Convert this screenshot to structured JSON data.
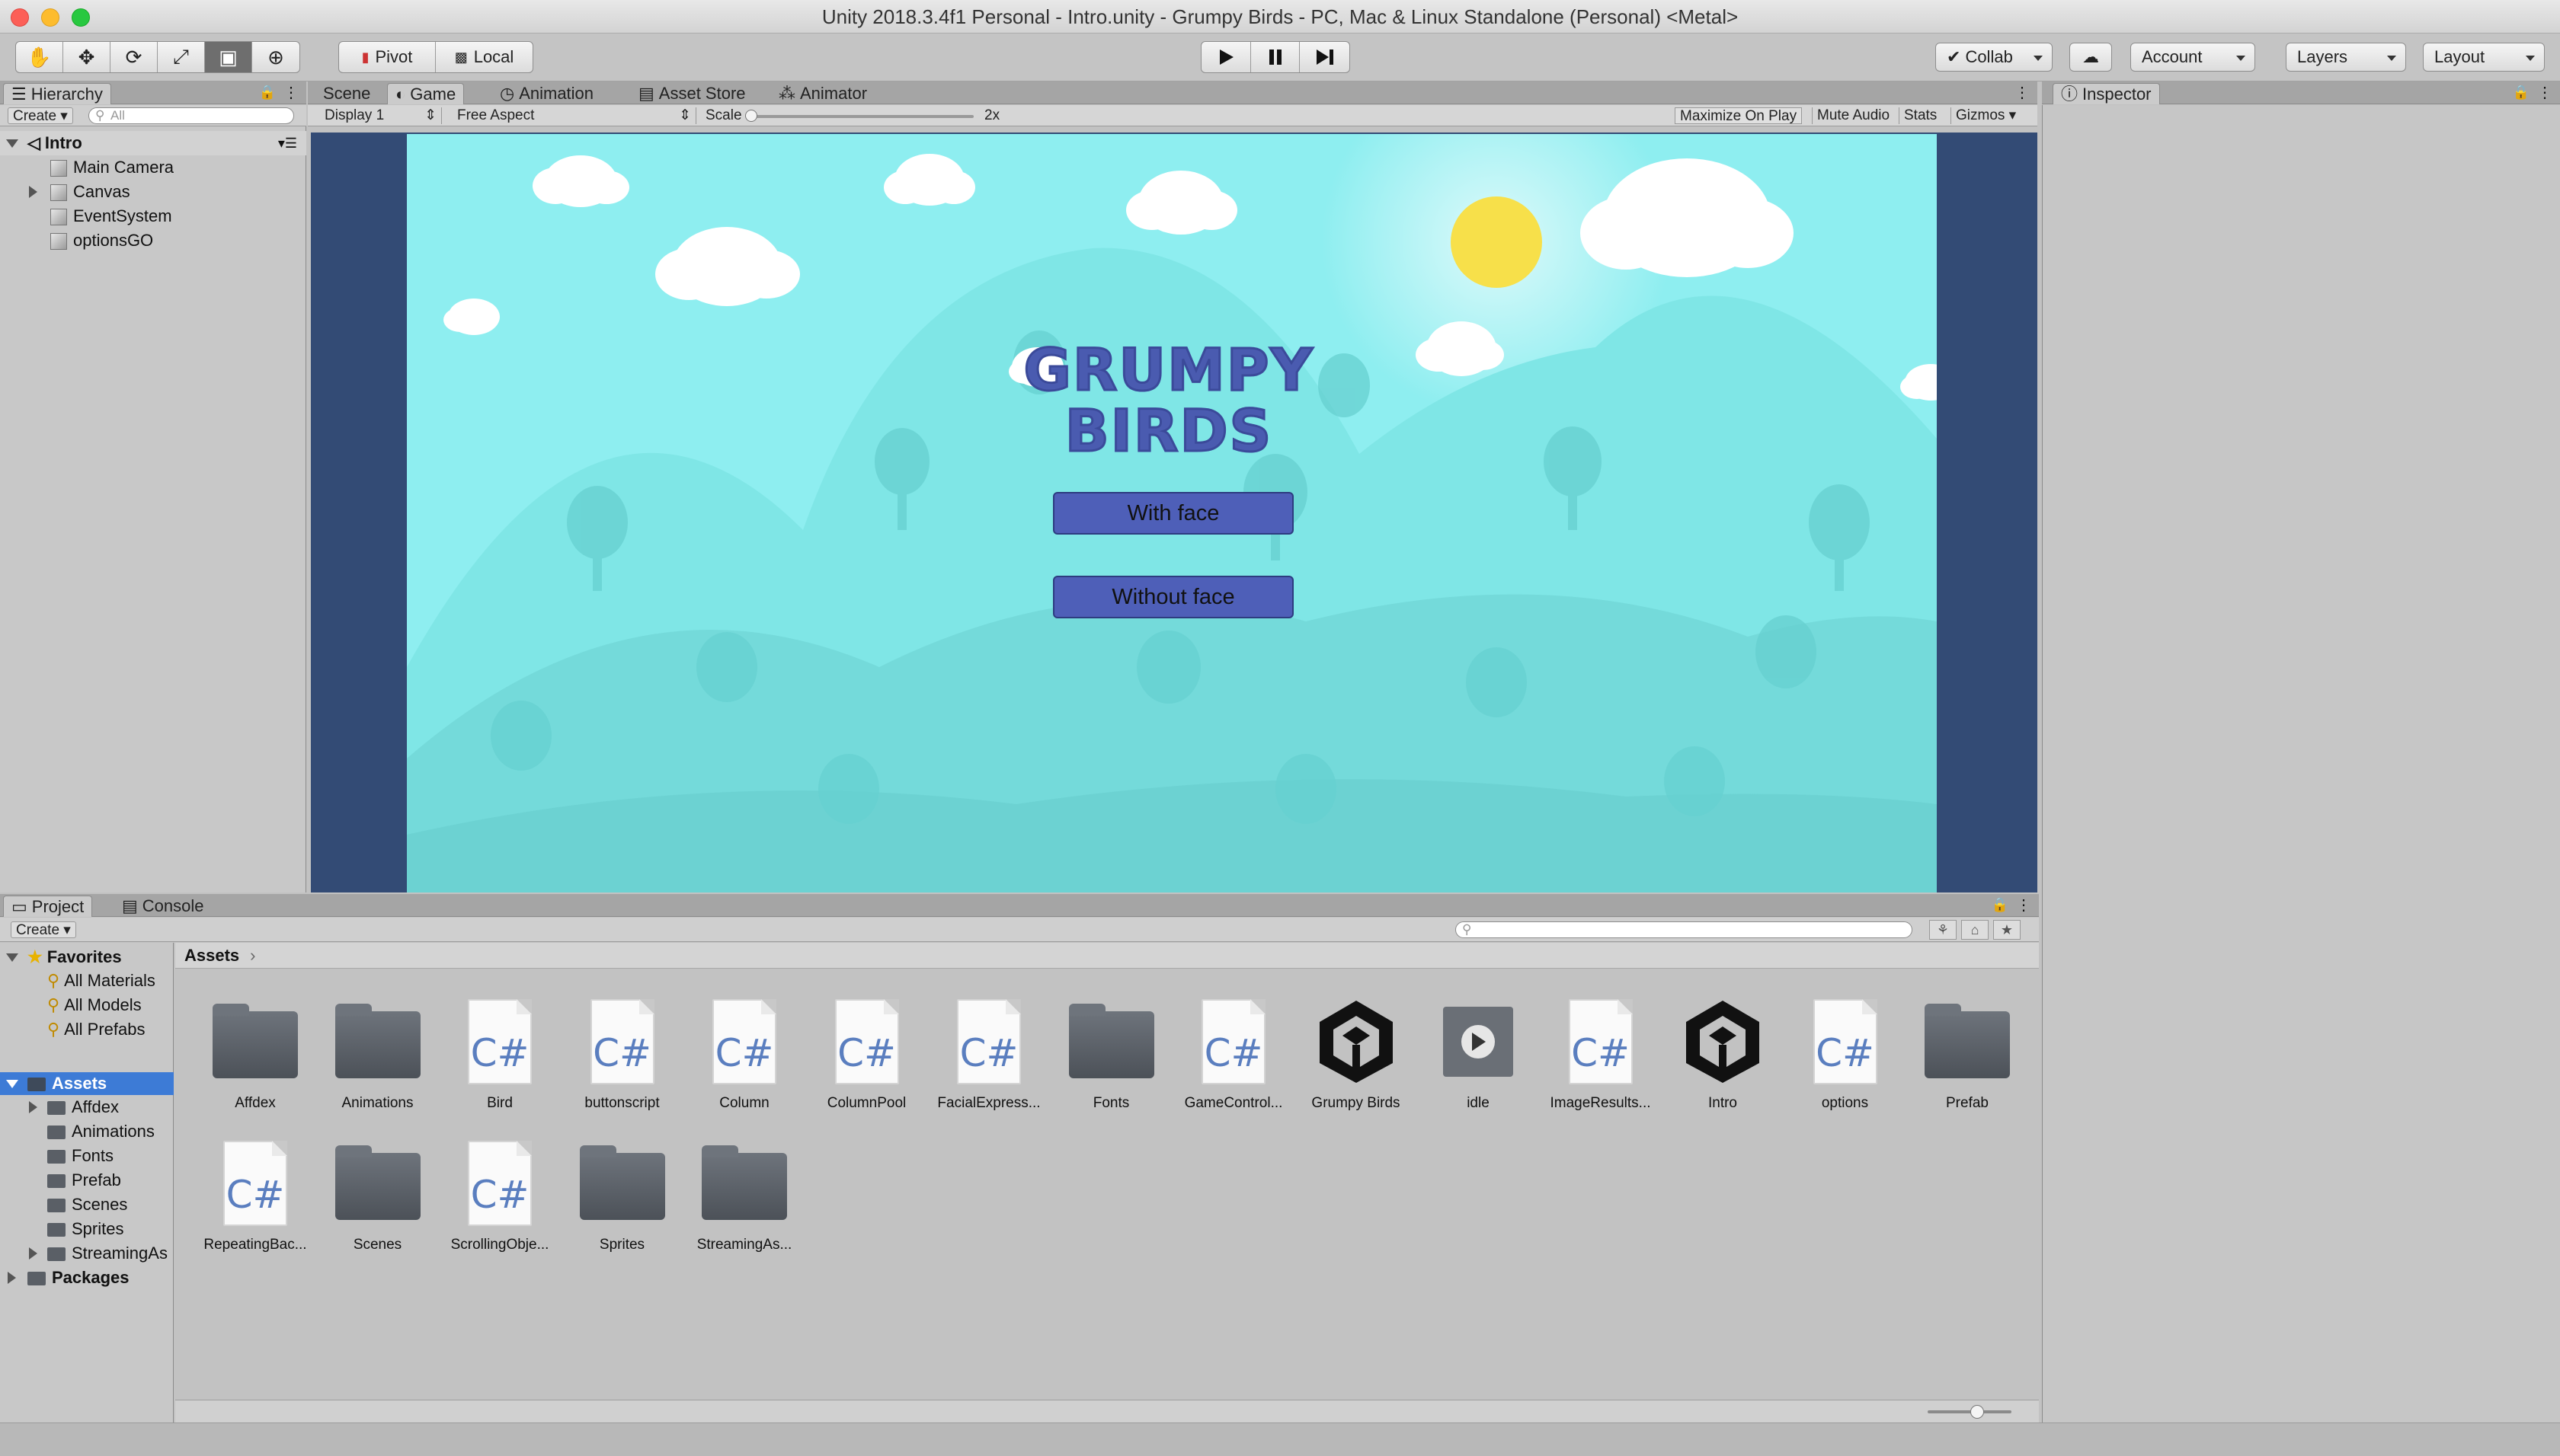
{
  "window": {
    "title": "Unity 2018.3.4f1 Personal - Intro.unity - Grumpy Birds - PC, Mac & Linux Standalone (Personal) <Metal>"
  },
  "toolbar": {
    "tools": [
      "hand-icon",
      "move-icon",
      "rotate-icon",
      "scale-icon",
      "rect-icon",
      "transform-icon"
    ],
    "pivot_label": "Pivot",
    "local_label": "Local",
    "collab_label": "Collab",
    "account_label": "Account",
    "layers_label": "Layers",
    "layout_label": "Layout"
  },
  "hierarchy": {
    "tab_label": "Hierarchy",
    "create_label": "Create",
    "search_placeholder": "All",
    "scene_name": "Intro",
    "items": [
      {
        "label": "Main Camera",
        "expandable": false
      },
      {
        "label": "Canvas",
        "expandable": true
      },
      {
        "label": "EventSystem",
        "expandable": false
      },
      {
        "label": "optionsGO",
        "expandable": false
      }
    ]
  },
  "center_tabs": {
    "scene": "Scene",
    "game": "Game",
    "animation": "Animation",
    "asset_store": "Asset Store",
    "animator": "Animator"
  },
  "game_bar": {
    "display": "Display 1",
    "aspect": "Free Aspect",
    "scale_label": "Scale",
    "scale_value": "2x",
    "maximize": "Maximize On Play",
    "mute": "Mute Audio",
    "stats": "Stats",
    "gizmos": "Gizmos"
  },
  "game": {
    "title_line1": "GRUMPY",
    "title_line2": "BIRDS",
    "btn_with_face": "With face",
    "btn_without_face": "Without face",
    "colors": {
      "sky": "#8eeef0",
      "hill": "#78e2e2",
      "title": "#4a5bb0",
      "button": "#4e5fb8",
      "sun": "#f7e04a",
      "letterbox": "#334b75"
    }
  },
  "inspector": {
    "tab_label": "Inspector"
  },
  "project": {
    "tab_project": "Project",
    "tab_console": "Console",
    "create_label": "Create",
    "favorites_label": "Favorites",
    "favorites": [
      "All Materials",
      "All Models",
      "All Prefabs"
    ],
    "assets_label": "Assets",
    "asset_folders": [
      "Affdex",
      "Animations",
      "Fonts",
      "Prefab",
      "Scenes",
      "Sprites",
      "StreamingAs"
    ],
    "packages_label": "Packages",
    "breadcrumb": "Assets",
    "grid": [
      {
        "label": "Affdex",
        "kind": "folder"
      },
      {
        "label": "Animations",
        "kind": "folder"
      },
      {
        "label": "Bird",
        "kind": "script"
      },
      {
        "label": "buttonscript",
        "kind": "script"
      },
      {
        "label": "Column",
        "kind": "script"
      },
      {
        "label": "ColumnPool",
        "kind": "script"
      },
      {
        "label": "FacialExpress...",
        "kind": "script"
      },
      {
        "label": "Fonts",
        "kind": "folder"
      },
      {
        "label": "GameControl...",
        "kind": "script"
      },
      {
        "label": "Grumpy Birds",
        "kind": "unity"
      },
      {
        "label": "idle",
        "kind": "anim"
      },
      {
        "label": "ImageResults...",
        "kind": "script"
      },
      {
        "label": "Intro",
        "kind": "unity"
      },
      {
        "label": "options",
        "kind": "script"
      },
      {
        "label": "Prefab",
        "kind": "folder"
      },
      {
        "label": "RepeatingBac...",
        "kind": "script"
      },
      {
        "label": "Scenes",
        "kind": "folder"
      },
      {
        "label": "ScrollingObje...",
        "kind": "script"
      },
      {
        "label": "Sprites",
        "kind": "folder"
      },
      {
        "label": "StreamingAs...",
        "kind": "folder"
      }
    ]
  }
}
